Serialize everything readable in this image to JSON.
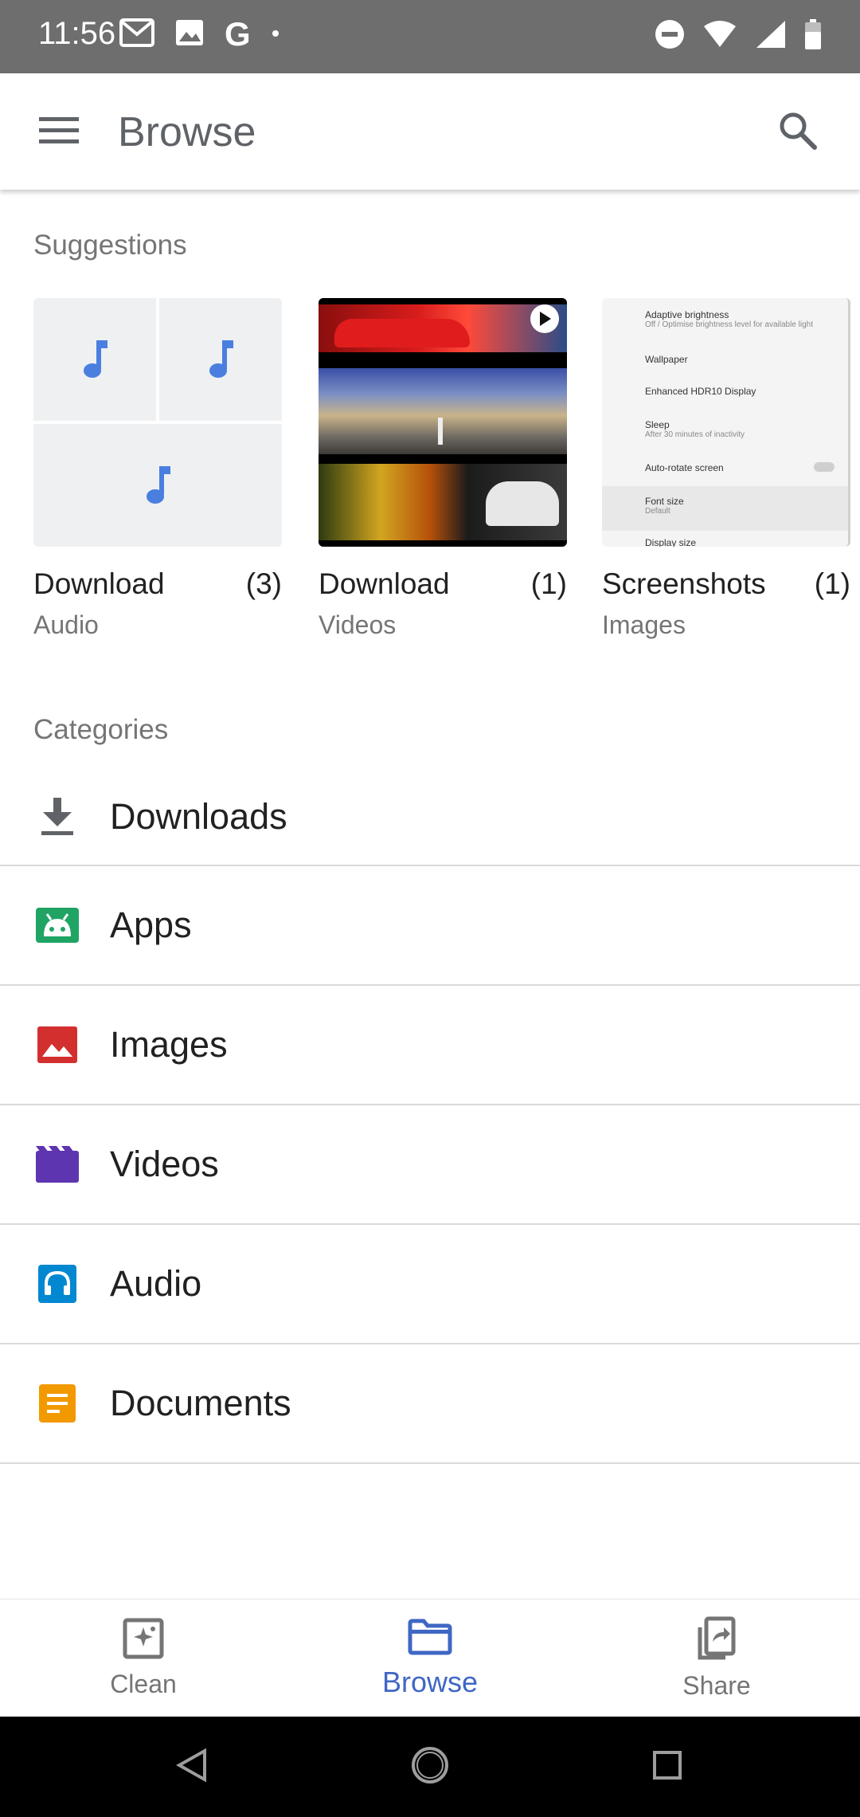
{
  "status_bar": {
    "time": "11:56",
    "left_icons": [
      "gmail-icon",
      "image-icon",
      "google-icon",
      "dot-icon"
    ],
    "right_icons": [
      "dnd-icon",
      "wifi-icon",
      "signal-icon",
      "battery-icon"
    ]
  },
  "app_bar": {
    "title": "Browse",
    "menu_icon": "menu-icon",
    "search_icon": "search-icon"
  },
  "suggestions": {
    "title": "Suggestions",
    "cards": [
      {
        "name": "Download",
        "count": "(3)",
        "type": "Audio"
      },
      {
        "name": "Download",
        "count": "(1)",
        "type": "Videos"
      },
      {
        "name": "Screenshots",
        "count": "(1)",
        "type": "Images"
      }
    ],
    "screenshot_preview": [
      {
        "title": "Adaptive brightness",
        "sub": "Off / Optimise brightness level for available light"
      },
      {
        "title": "Wallpaper",
        "sub": ""
      },
      {
        "title": "Enhanced HDR10 Display",
        "sub": ""
      },
      {
        "title": "Sleep",
        "sub": "After 30 minutes of inactivity"
      },
      {
        "title": "Auto-rotate screen",
        "sub": ""
      },
      {
        "title": "Font size",
        "sub": "Default"
      },
      {
        "title": "Display size",
        "sub": ""
      }
    ]
  },
  "categories": {
    "title": "Categories",
    "items": [
      {
        "label": "Downloads",
        "icon": "download-icon",
        "color": "#5f6368"
      },
      {
        "label": "Apps",
        "icon": "android-icon",
        "color": "#1fa463"
      },
      {
        "label": "Images",
        "icon": "image-icon",
        "color": "#d32f2f"
      },
      {
        "label": "Videos",
        "icon": "video-icon",
        "color": "#5e35b1"
      },
      {
        "label": "Audio",
        "icon": "headphones-icon",
        "color": "#0288d1"
      },
      {
        "label": "Documents",
        "icon": "document-icon",
        "color": "#f29900"
      }
    ]
  },
  "bottom_nav": {
    "items": [
      {
        "label": "Clean",
        "icon": "clean-icon",
        "active": false
      },
      {
        "label": "Browse",
        "icon": "folder-icon",
        "active": true
      },
      {
        "label": "Share",
        "icon": "share-icon",
        "active": false
      }
    ],
    "active_color": "#3f67c4"
  },
  "system_nav": [
    "back-icon",
    "home-icon",
    "recents-icon"
  ]
}
